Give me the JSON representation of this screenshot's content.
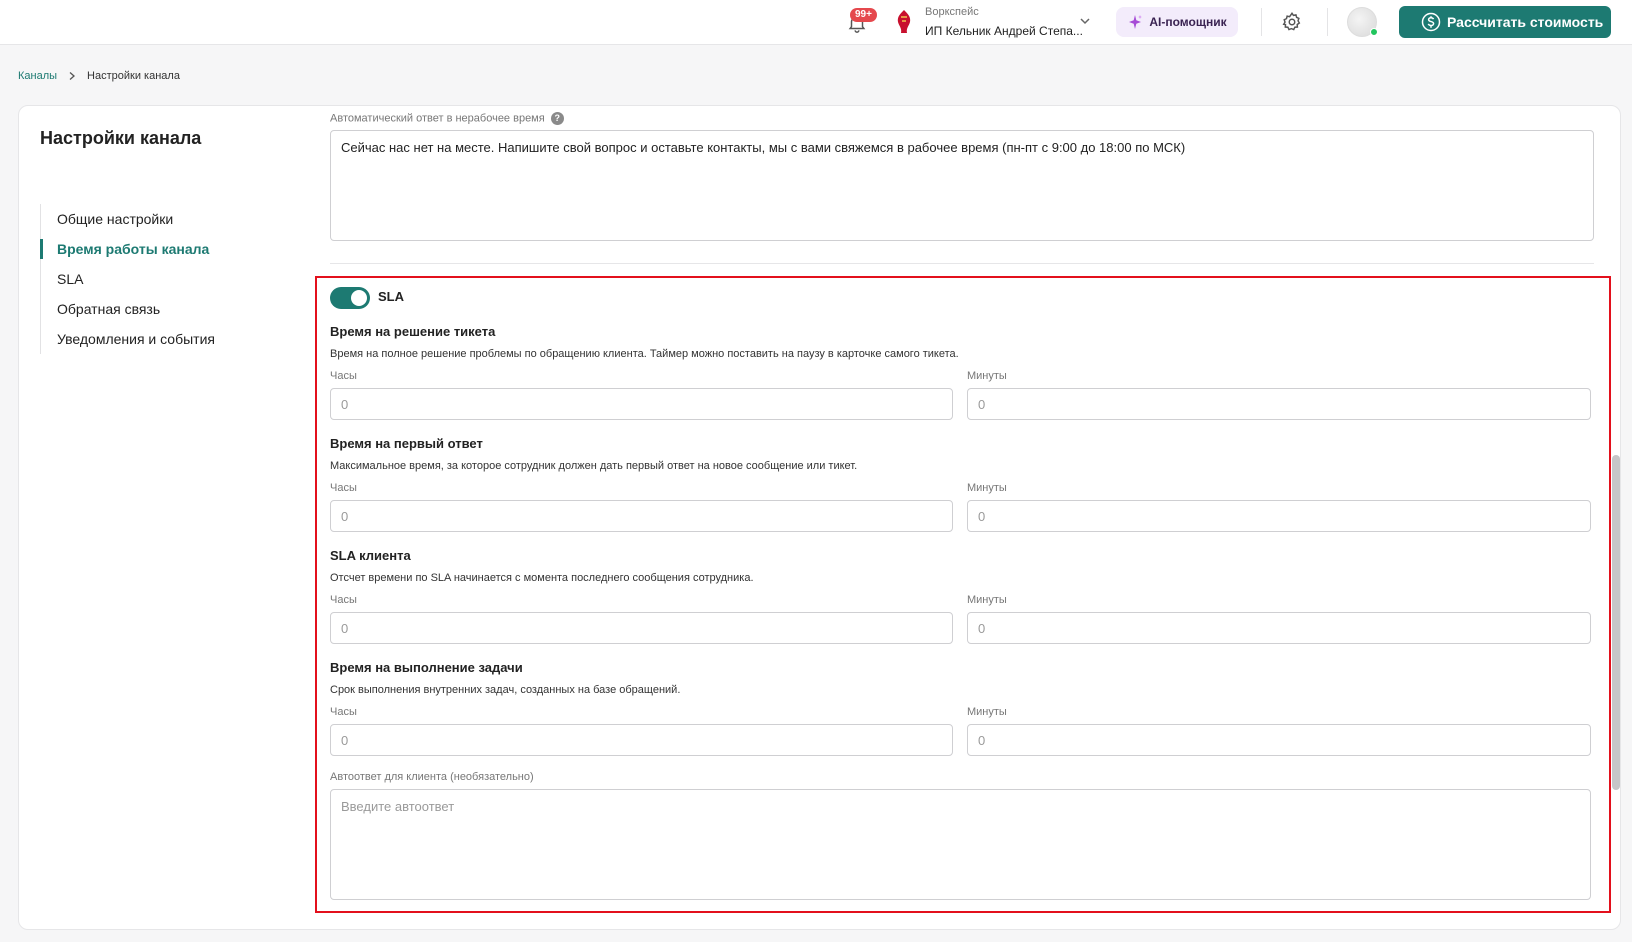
{
  "header": {
    "notifications_badge": "99+",
    "workspace_caption": "Воркспейс",
    "workspace_name": "ИП Кельник Андрей Степа...",
    "ai_button": "AI-помощник",
    "calc_button": "Рассчитать стоимость"
  },
  "breadcrumb": {
    "root": "Каналы",
    "current": "Настройки канала"
  },
  "page_title": "Настройки канала",
  "side_nav": {
    "items": [
      {
        "label": "Общие настройки",
        "active": false
      },
      {
        "label": "Время работы канала",
        "active": true
      },
      {
        "label": "SLA",
        "active": false
      },
      {
        "label": "Обратная связь",
        "active": false
      },
      {
        "label": "Уведомления и события",
        "active": false
      }
    ]
  },
  "auto_reply_offhours": {
    "label": "Автоматический ответ в нерабочее время",
    "value": "Сейчас нас нет на месте. Напишите свой вопрос и оставьте контакты, мы с вами свяжемся в рабочее время (пн-пт с 9:00 до 18:00 по МСК)"
  },
  "sla": {
    "toggle_label": "SLA",
    "toggle_on": true,
    "hours_label": "Часы",
    "minutes_label": "Минуты",
    "sections": [
      {
        "title": "Время на решение тикета",
        "description": "Время на полное решение проблемы по обращению клиента. Таймер можно поставить на паузу в карточке самого тикета.",
        "hours_placeholder": "0",
        "minutes_placeholder": "0"
      },
      {
        "title": "Время на первый ответ",
        "description": "Максимальное время, за которое сотрудник должен дать первый ответ на новое сообщение или тикет.",
        "hours_placeholder": "0",
        "minutes_placeholder": "0"
      },
      {
        "title": "SLA клиента",
        "description": "Отсчет времени по SLA начинается с момента последнего сообщения сотрудника.",
        "hours_placeholder": "0",
        "minutes_placeholder": "0"
      },
      {
        "title": "Время на выполнение задачи",
        "description": "Срок выполнения внутренних задач, созданных на базе обращений.",
        "hours_placeholder": "0",
        "minutes_placeholder": "0"
      }
    ],
    "client_autoreply": {
      "label": "Автоответ для клиента (необязательно)",
      "placeholder": "Введите автоответ"
    }
  },
  "colors": {
    "accent": "#1d7a72",
    "highlight": "#e3101c",
    "badge": "#e5484d"
  }
}
